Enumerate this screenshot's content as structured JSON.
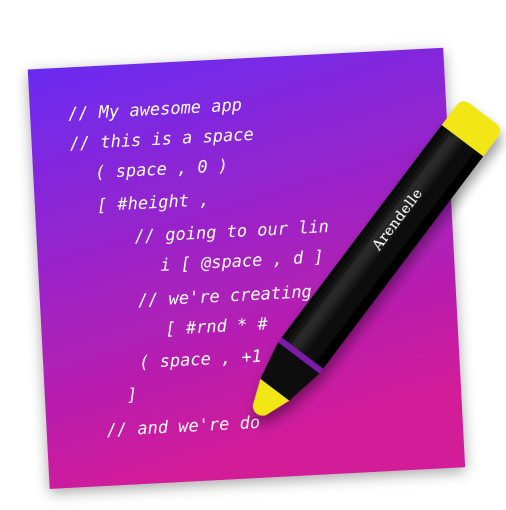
{
  "icon": {
    "pen_label": "Arendelle",
    "code_lines": [
      "// My awesome app",
      "// this is a space",
      "( space , 0 )",
      "[ #height ,",
      "// going to our lin",
      "i [ @space , d ]",
      "// we're creating rnd",
      "[ #rnd * #",
      "( space , +1 ]",
      "]",
      "// and we're do"
    ],
    "colors": {
      "paper_top": "#6a2cf2",
      "paper_bottom": "#d21a98",
      "pen_body": "#0b0b0b",
      "pen_accent": "#f2e616",
      "pen_band": "#7a1aa8"
    }
  }
}
